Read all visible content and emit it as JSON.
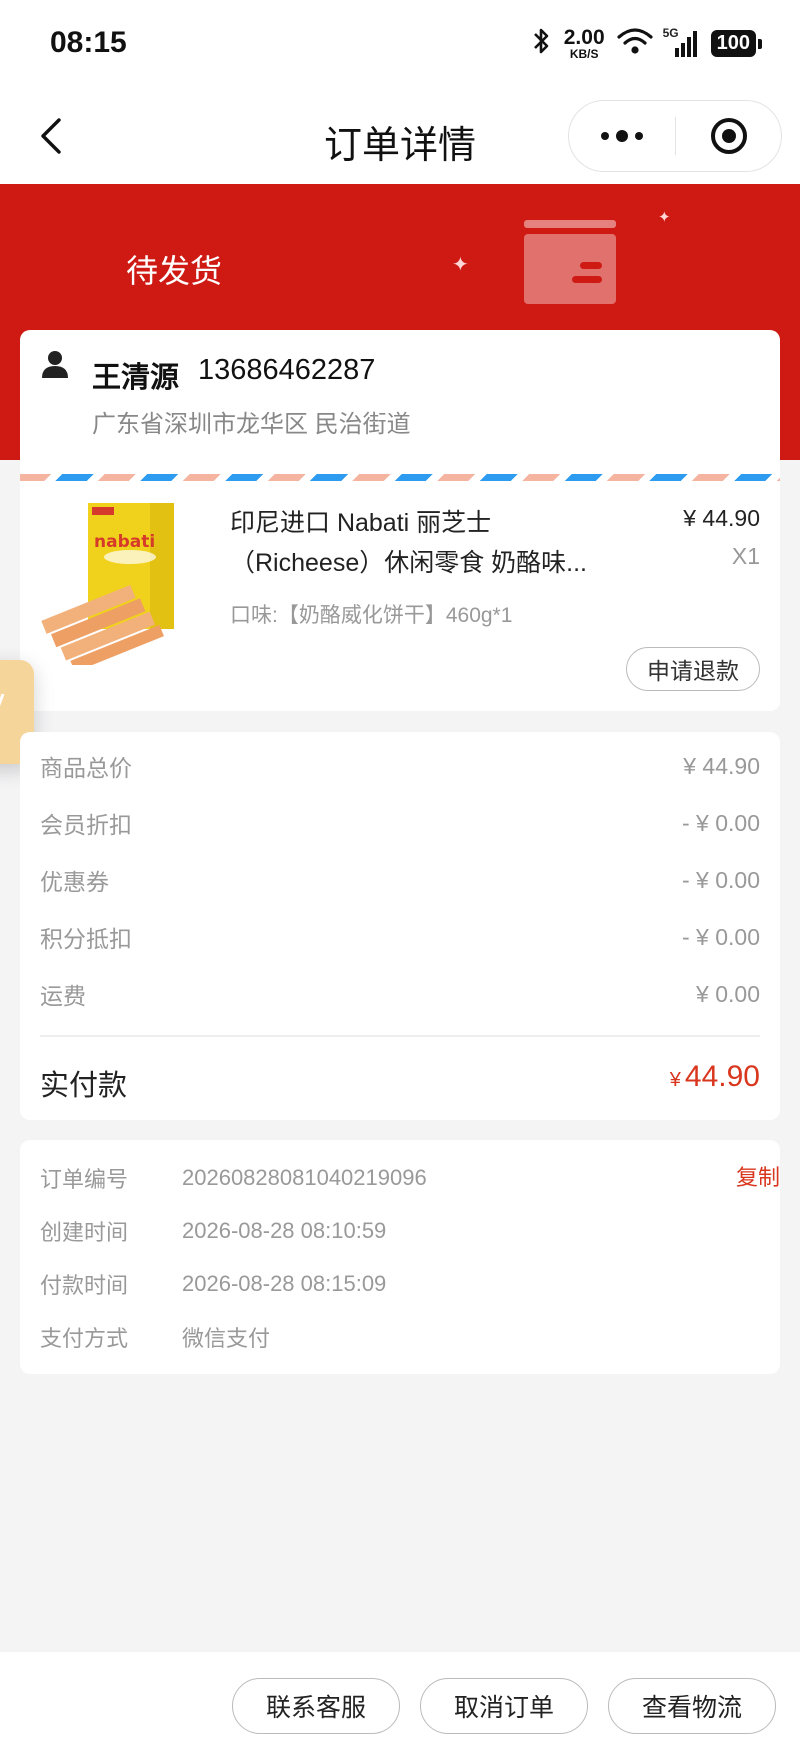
{
  "status_bar": {
    "time": "08:15",
    "net_speed": "2.00",
    "net_unit": "KB/S",
    "network": "5G",
    "battery": "100"
  },
  "nav": {
    "title": "订单详情"
  },
  "order_status": "待发货",
  "address": {
    "name": "王清源",
    "phone": "13686462287",
    "detail": "广东省深圳市龙华区 民治街道"
  },
  "product": {
    "title": "印尼进口 Nabati 丽芝士（Richeese）休闲零食 奶酪味...",
    "price": "¥ 44.90",
    "qty": "X1",
    "spec": "口味:【奶酪威化饼干】460g*1",
    "refund_label": "申请退款",
    "brand_text": "nabati"
  },
  "price_summary": {
    "rows": [
      {
        "label": "商品总价",
        "value": "¥ 44.90"
      },
      {
        "label": "会员折扣",
        "value": "- ¥ 0.00"
      },
      {
        "label": "优惠券",
        "value": "- ¥ 0.00"
      },
      {
        "label": "积分抵扣",
        "value": "- ¥ 0.00"
      },
      {
        "label": "运费",
        "value": "¥ 0.00"
      }
    ],
    "total_label": "实付款",
    "total_currency": "¥",
    "total_value": "44.90"
  },
  "order_info": {
    "rows": [
      {
        "label": "订单编号",
        "value": "20260828081040219096"
      },
      {
        "label": "创建时间",
        "value": "2026-08-28 08:10:59"
      },
      {
        "label": "付款时间",
        "value": "2026-08-28 08:15:09"
      },
      {
        "label": "支付方式",
        "value": "微信支付"
      }
    ],
    "copy_label": "复制"
  },
  "actions": {
    "contact": "联系客服",
    "cancel": "取消订单",
    "logistics": "查看物流"
  },
  "colors": {
    "hero_red": "#cf1a14",
    "accent_red": "#d9361e",
    "stripe_blue": "#2d9bf0",
    "stripe_pink": "#f4b4a0"
  }
}
